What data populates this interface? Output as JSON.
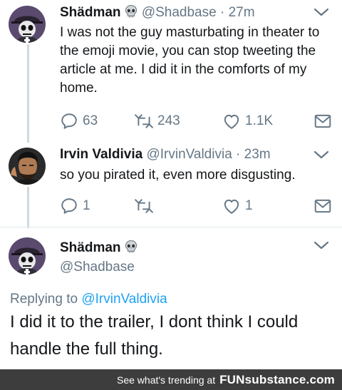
{
  "tweet1": {
    "name": "Shädman",
    "handle": "@Shadbase",
    "dot": "·",
    "time": "27m",
    "text": "I was not the guy masturbating in theater to the emoji movie, you can stop tweeting the article at me. I did it in the comforts of my home.",
    "replies": "63",
    "retweets": "243",
    "likes": "1.1K"
  },
  "tweet2": {
    "name": "Irvin Valdivia",
    "handle": "@IrvinValdivia",
    "dot": "·",
    "time": "23m",
    "text": "so you pirated it, even more disgusting.",
    "replies": "1",
    "retweets": "",
    "likes": "1"
  },
  "tweet3": {
    "name": "Shädman",
    "handle": "@Shadbase",
    "replying_prefix": "Replying to ",
    "replying_to": "@IrvinValdivia",
    "text": "I did it to the trailer, I dont think I could handle the full thing."
  },
  "footer": {
    "text": "See what's trending at",
    "brand": "FUNsubstance.com"
  },
  "icons": {
    "reply": "reply-icon",
    "retweet": "retweet-icon",
    "like": "heart-icon",
    "message": "envelope-icon",
    "menu": "chevron-down-icon",
    "emoji": "skull-icon"
  },
  "colors": {
    "text": "#14171a",
    "muted": "#657786",
    "link": "#1da1f2",
    "footer_bg": "#3d3d3d"
  }
}
